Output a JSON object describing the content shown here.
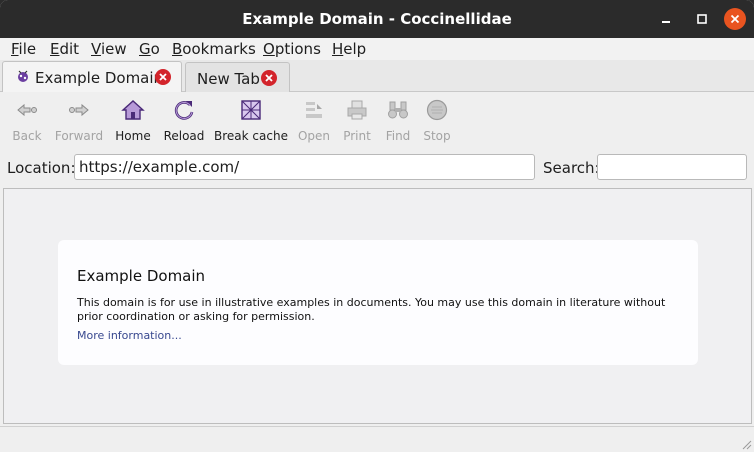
{
  "window": {
    "title": "Example Domain - Coccinellidae",
    "close_color": "#e95420"
  },
  "menu": {
    "items": [
      "File",
      "Edit",
      "View",
      "Go",
      "Bookmarks",
      "Options",
      "Help"
    ]
  },
  "tabs": [
    {
      "label": "Example Domain",
      "active": true,
      "icon": "bug-favicon-icon"
    },
    {
      "label": "New Tab",
      "active": false
    }
  ],
  "toolbar": {
    "items": [
      {
        "label": "Back",
        "icon": "back-arrow-icon",
        "enabled": false
      },
      {
        "label": "Forward",
        "icon": "forward-arrow-icon",
        "enabled": false
      },
      {
        "label": "Home",
        "icon": "home-icon",
        "enabled": true
      },
      {
        "label": "Reload",
        "icon": "reload-icon",
        "enabled": true
      },
      {
        "label": "Break cache",
        "icon": "break-cache-icon",
        "enabled": true
      },
      {
        "label": "Open",
        "icon": "open-icon",
        "enabled": false
      },
      {
        "label": "Print",
        "icon": "print-icon",
        "enabled": false
      },
      {
        "label": "Find",
        "icon": "binoculars-icon",
        "enabled": false
      },
      {
        "label": "Stop",
        "icon": "stop-icon",
        "enabled": false
      }
    ]
  },
  "location": {
    "label": "Location:",
    "value": "https://example.com/"
  },
  "search": {
    "label": "Search:",
    "value": ""
  },
  "page": {
    "heading": "Example Domain",
    "body": "This domain is for use in illustrative examples in documents. You may use this domain in literature without prior coordination or asking for permission.",
    "link": "More information..."
  },
  "colors": {
    "tab_close": "#d3242b",
    "link": "#38488f",
    "icon_purple": "#6b3fa0"
  }
}
